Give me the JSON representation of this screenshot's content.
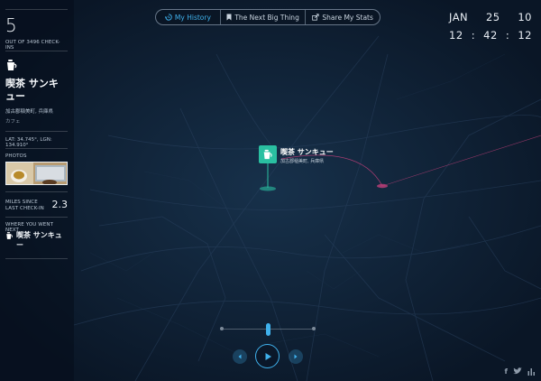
{
  "sidebar": {
    "checkin_count": "5",
    "checkin_caption": "OUT OF 3496 CHECK-INS",
    "venue_icon": "teapot-icon",
    "venue_name": "喫茶 サンキュー",
    "venue_location": "加古郡稲美町, 兵庫県",
    "venue_category": "カフェ",
    "coords": "LAT: 34.745°, LGN: 134.910°",
    "photos_label": "PHOTOS",
    "miles_label_1": "MILES SINCE",
    "miles_label_2": "LAST CHECK-IN",
    "miles_value": "2.3",
    "next_label": "WHERE YOU WENT NEXT",
    "next_venue": "喫茶 サンキュー"
  },
  "nav": {
    "items": [
      {
        "label": "My History",
        "icon": "history-icon",
        "active": true
      },
      {
        "label": "The Next Big Thing",
        "icon": "bookmark-icon",
        "active": false
      },
      {
        "label": "Share My Stats",
        "icon": "share-icon",
        "active": false
      }
    ]
  },
  "clock": {
    "month": "JAN",
    "day": "25",
    "year": "10",
    "hour": "12",
    "minute": "42",
    "second": "12"
  },
  "marker": {
    "icon": "teapot-icon",
    "name": "喫茶 サンキュー",
    "location": "加古郡稲美町, 兵庫県"
  },
  "playback": {
    "prev_icon": "chevron-left-icon",
    "play_icon": "play-icon",
    "next_icon": "chevron-right-icon"
  },
  "social": {
    "icons": [
      "facebook-icon",
      "twitter-icon",
      "stats-icon"
    ]
  },
  "colors": {
    "accent": "#3fb1ec",
    "marker": "#2abfa1",
    "background": "#0c1a2c",
    "trail": "#c2407a"
  }
}
